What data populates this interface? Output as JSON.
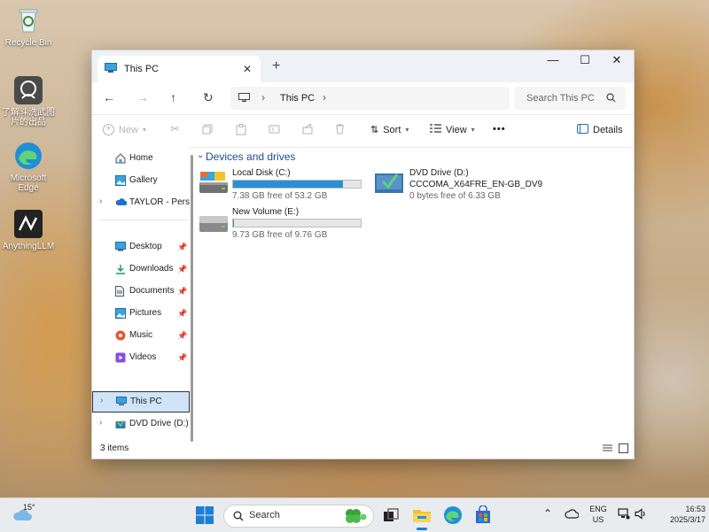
{
  "desktop": {
    "icons": [
      {
        "label": "Recycle Bin"
      },
      {
        "label": "了解斗洗武图片的出品"
      },
      {
        "label": "Microsoft Edge"
      },
      {
        "label": "AnythingLLM"
      }
    ]
  },
  "window": {
    "tab_title": "This PC",
    "tab_close": "✕",
    "new_tab": "+",
    "controls": {
      "minimize": "—",
      "maximize": "☐",
      "close": "✕"
    },
    "nav": {
      "back": "←",
      "forward": "→",
      "up": "↑",
      "refresh": "↻"
    },
    "address": {
      "location": "This PC",
      "separator": "›",
      "trailing": "›"
    },
    "search": {
      "placeholder": "Search This PC"
    },
    "toolbar": {
      "new_label": "New",
      "sort_label": "Sort",
      "view_label": "View",
      "more_label": "•••",
      "details_label": "Details"
    },
    "sidebar": {
      "items": [
        {
          "label": "Home"
        },
        {
          "label": "Gallery"
        },
        {
          "label": "TAYLOR - Person"
        },
        {
          "label": "Desktop"
        },
        {
          "label": "Downloads"
        },
        {
          "label": "Documents"
        },
        {
          "label": "Pictures"
        },
        {
          "label": "Music"
        },
        {
          "label": "Videos"
        },
        {
          "label": "This PC"
        },
        {
          "label": "DVD Drive (D:) C"
        }
      ]
    },
    "content": {
      "group_title": "Devices and drives",
      "drives": [
        {
          "name": "Local Disk (C:)",
          "free": "7.38 GB free of 53.2 GB",
          "used_fraction": 0.86
        },
        {
          "name": "New Volume (E:)",
          "free": "9.73 GB free of 9.76 GB",
          "used_fraction": 0.003
        },
        {
          "name": "DVD Drive (D:)",
          "subtitle": "CCCOMA_X64FRE_EN-GB_DV9",
          "free": "0 bytes free of 6.33 GB"
        }
      ]
    },
    "status": {
      "items_count": "3 items"
    }
  },
  "taskbar": {
    "weather": "15°",
    "search_label": "Search",
    "lang_top": "ENG",
    "lang_bottom": "US",
    "time": "16:53",
    "date": "2025/3/17"
  },
  "colors": {
    "accent": "#2b8fd8",
    "selection": "#cfe4f7"
  }
}
